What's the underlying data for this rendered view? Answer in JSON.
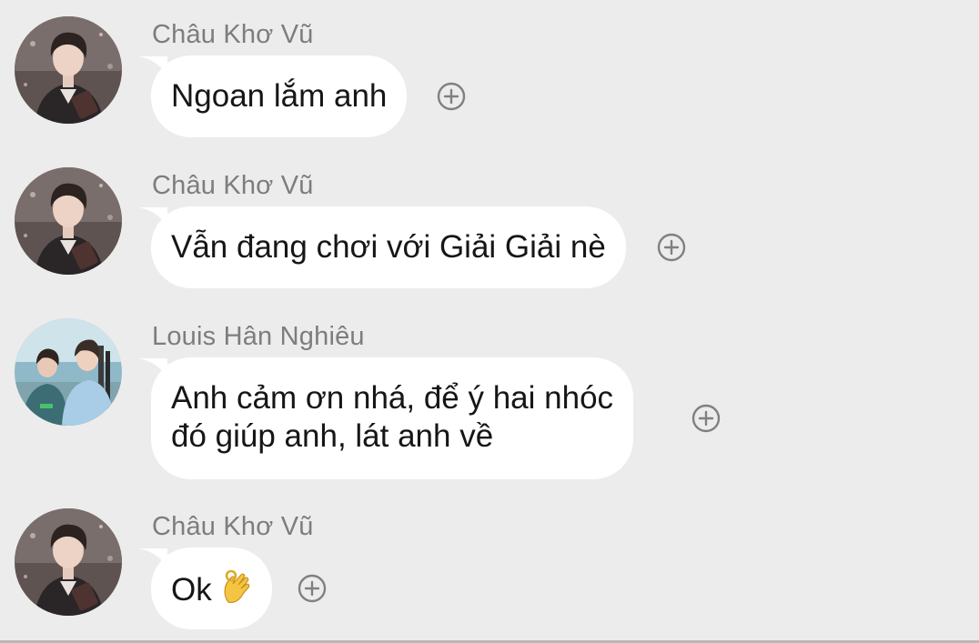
{
  "messages": [
    {
      "sender": "Châu Khơ Vũ",
      "text": "Ngoan lắm anh",
      "avatar_icon": "avatar-chau-kho-vu"
    },
    {
      "sender": "Châu Khơ Vũ",
      "text": "Vẫn đang chơi với Giải Giải nè",
      "avatar_icon": "avatar-chau-kho-vu"
    },
    {
      "sender": "Louis Hân Nghiêu",
      "text_line1": "Anh cảm ơn nhá, để ý hai nhóc",
      "text_line2": "đó giúp anh, lát anh về",
      "avatar_icon": "avatar-louis-han-nghieu"
    },
    {
      "sender": "Châu Khơ Vũ",
      "text": "Ok",
      "emoji": "ok-hand-emoji",
      "avatar_icon": "avatar-chau-kho-vu"
    }
  ],
  "icons": {
    "react": "plus-circle-icon"
  },
  "colors": {
    "background": "#ececec",
    "bubble": "#ffffff",
    "sender_text": "#7d7d7d",
    "message_text": "#161616",
    "icon": "#808080"
  }
}
